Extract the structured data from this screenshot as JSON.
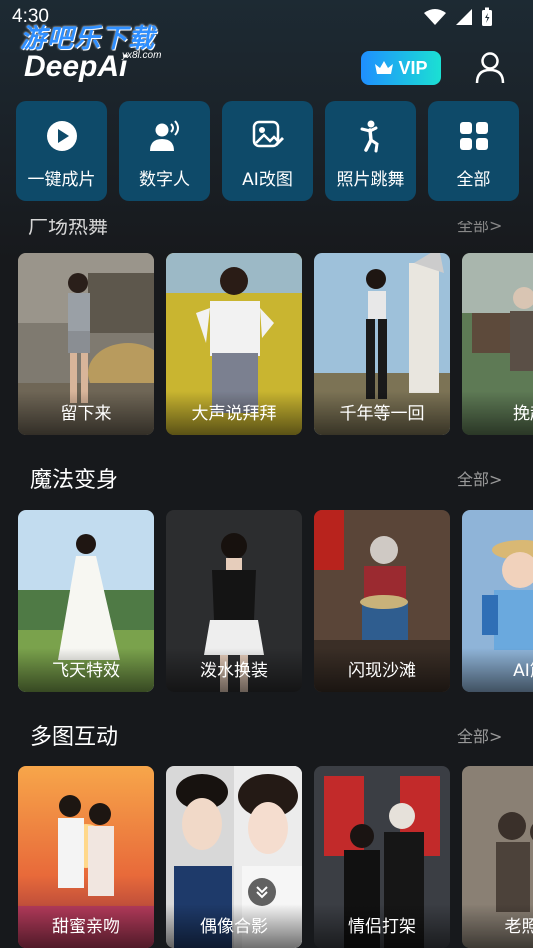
{
  "status": {
    "time": "4:30"
  },
  "watermark": {
    "text": "游吧乐下载",
    "sub": "yx8l.com"
  },
  "header": {
    "brand": "DeepAi",
    "vip_label": "VIP"
  },
  "quick_actions": [
    {
      "label": "一键成片",
      "icon": "play-circle-icon"
    },
    {
      "label": "数字人",
      "icon": "digital-human-icon"
    },
    {
      "label": "AI改图",
      "icon": "image-edit-icon"
    },
    {
      "label": "照片跳舞",
      "icon": "dance-icon"
    },
    {
      "label": "全部",
      "icon": "grid-icon"
    }
  ],
  "section0": {
    "title": "广场热舞",
    "more": "全部",
    "cards": [
      {
        "label": "留下来"
      },
      {
        "label": "大声说拜拜"
      },
      {
        "label": "千年等一回"
      },
      {
        "label": "挽起"
      }
    ]
  },
  "section1": {
    "title": "魔法变身",
    "more": "全部",
    "cards": [
      {
        "label": "飞天特效"
      },
      {
        "label": "泼水换装"
      },
      {
        "label": "闪现沙滩"
      },
      {
        "label": "AI筋"
      }
    ]
  },
  "section2": {
    "title": "多图互动",
    "more": "全部",
    "cards": [
      {
        "label": "甜蜜亲吻"
      },
      {
        "label": "偶像合影"
      },
      {
        "label": "情侣打架"
      },
      {
        "label": "老照片"
      }
    ]
  },
  "colors": {
    "accent": "#0e4a69",
    "vip_from": "#1f8fff",
    "vip_to": "#1be0d3",
    "bg": "#17191c"
  }
}
